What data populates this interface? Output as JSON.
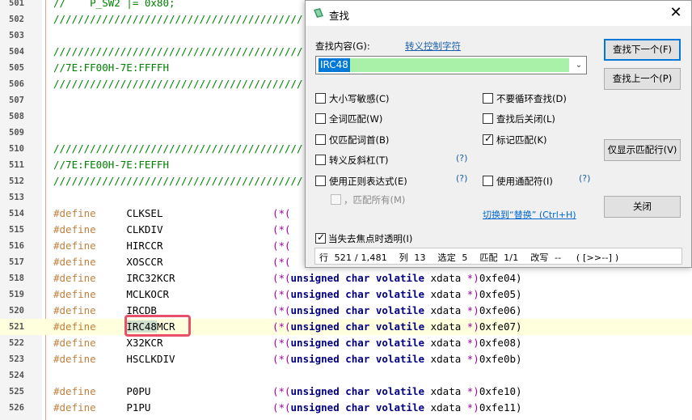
{
  "editor": {
    "lines": [
      {
        "num": "501",
        "parts": [
          [
            "cmt",
            "//    P_SW2 |= 0x80;"
          ]
        ]
      },
      {
        "num": "502",
        "parts": [
          [
            "cmt",
            "/////////////////////////////////////////"
          ]
        ]
      },
      {
        "num": "503",
        "parts": []
      },
      {
        "num": "504",
        "parts": [
          [
            "cmt",
            "/////////////////////////////////////////"
          ]
        ]
      },
      {
        "num": "505",
        "parts": [
          [
            "cmt",
            "//7E:FF00H-7E:FFFFH"
          ]
        ]
      },
      {
        "num": "506",
        "parts": [
          [
            "cmt",
            "/////////////////////////////////////////"
          ]
        ]
      },
      {
        "num": "507",
        "parts": []
      },
      {
        "num": "508",
        "parts": []
      },
      {
        "num": "509",
        "parts": []
      },
      {
        "num": "510",
        "parts": [
          [
            "cmt",
            "/////////////////////////////////////////"
          ]
        ]
      },
      {
        "num": "511",
        "parts": [
          [
            "cmt",
            "//7E:FE00H-7E:FEFFH"
          ]
        ]
      },
      {
        "num": "512",
        "parts": [
          [
            "cmt",
            "/////////////////////////////////////////"
          ]
        ]
      },
      {
        "num": "513",
        "parts": []
      },
      {
        "num": "514",
        "parts": [
          [
            "kw-define",
            "#define     "
          ],
          [
            "name",
            "CLKSEL                  "
          ],
          [
            "par",
            "(*("
          ]
        ]
      },
      {
        "num": "515",
        "parts": [
          [
            "kw-define",
            "#define     "
          ],
          [
            "name",
            "CLKDIV                  "
          ],
          [
            "par",
            "(*("
          ]
        ]
      },
      {
        "num": "516",
        "parts": [
          [
            "kw-define",
            "#define     "
          ],
          [
            "name",
            "HIRCCR                  "
          ],
          [
            "par",
            "(*("
          ]
        ]
      },
      {
        "num": "517",
        "parts": [
          [
            "kw-define",
            "#define     "
          ],
          [
            "name",
            "XOSCCR                  "
          ],
          [
            "par",
            "(*("
          ]
        ]
      },
      {
        "num": "518",
        "parts": [
          [
            "kw-define",
            "#define     "
          ],
          [
            "name",
            "IRC32KCR                "
          ],
          [
            "par",
            "(*("
          ],
          [
            "ty",
            "unsigned char volatile"
          ],
          [
            "hex",
            " xdata "
          ],
          [
            "par",
            "*)"
          ],
          [
            "hex",
            "0xfe04)"
          ]
        ]
      },
      {
        "num": "519",
        "parts": [
          [
            "kw-define",
            "#define     "
          ],
          [
            "name",
            "MCLKOCR                 "
          ],
          [
            "par",
            "(*("
          ],
          [
            "ty",
            "unsigned char volatile"
          ],
          [
            "hex",
            " xdata "
          ],
          [
            "par",
            "*)"
          ],
          [
            "hex",
            "0xfe05)"
          ]
        ]
      },
      {
        "num": "520",
        "parts": [
          [
            "kw-define",
            "#define     "
          ],
          [
            "name",
            "IRCDB                   "
          ],
          [
            "par",
            "(*("
          ],
          [
            "ty",
            "unsigned char volatile"
          ],
          [
            "hex",
            " xdata "
          ],
          [
            "par",
            "*)"
          ],
          [
            "hex",
            "0xfe06)"
          ]
        ]
      },
      {
        "num": "521",
        "current": true,
        "parts": [
          [
            "kw-define",
            "#define     "
          ],
          [
            "match",
            "IRC48"
          ],
          [
            "name",
            "MCR                "
          ],
          [
            "par",
            "(*("
          ],
          [
            "ty",
            "unsigned char volatile"
          ],
          [
            "hex",
            " xdata "
          ],
          [
            "par",
            "*)"
          ],
          [
            "hex",
            "0xfe07)"
          ]
        ]
      },
      {
        "num": "522",
        "parts": [
          [
            "kw-define",
            "#define     "
          ],
          [
            "name",
            "X32KCR                  "
          ],
          [
            "par",
            "(*("
          ],
          [
            "ty",
            "unsigned char volatile"
          ],
          [
            "hex",
            " xdata "
          ],
          [
            "par",
            "*)"
          ],
          [
            "hex",
            "0xfe08)"
          ]
        ]
      },
      {
        "num": "523",
        "parts": [
          [
            "kw-define",
            "#define     "
          ],
          [
            "name",
            "HSCLKDIV                "
          ],
          [
            "par",
            "(*("
          ],
          [
            "ty",
            "unsigned char volatile"
          ],
          [
            "hex",
            " xdata "
          ],
          [
            "par",
            "*)"
          ],
          [
            "hex",
            "0xfe0b)"
          ]
        ]
      },
      {
        "num": "524",
        "parts": []
      },
      {
        "num": "525",
        "parts": [
          [
            "kw-define",
            "#define     "
          ],
          [
            "name",
            "P0PU                    "
          ],
          [
            "par",
            "(*("
          ],
          [
            "ty",
            "unsigned char volatile"
          ],
          [
            "hex",
            " xdata "
          ],
          [
            "par",
            "*)"
          ],
          [
            "hex",
            "0xfe10)"
          ]
        ]
      },
      {
        "num": "526",
        "parts": [
          [
            "kw-define",
            "#define     "
          ],
          [
            "name",
            "P1PU                    "
          ],
          [
            "par",
            "(*("
          ],
          [
            "ty",
            "unsigned char volatile"
          ],
          [
            "hex",
            " xdata "
          ],
          [
            "par",
            "*)"
          ],
          [
            "hex",
            "0xfe11)"
          ]
        ]
      }
    ]
  },
  "dialog": {
    "title": "查找",
    "find_label": "查找内容(G):",
    "escape_link": "转义控制字符",
    "find_value": "IRC48",
    "buttons": {
      "find_next": "查找下一个(F)",
      "find_prev": "查找上一个(P)",
      "show_matches": "仅显示匹配行(V)",
      "close": "关闭"
    },
    "options_left": [
      {
        "label": "大小写敏感(C)",
        "checked": false
      },
      {
        "label": "全词匹配(W)",
        "checked": false
      },
      {
        "label": "仅匹配词首(B)",
        "checked": false
      },
      {
        "label": "转义反斜杠(T)",
        "checked": false
      },
      {
        "label": "使用正则表达式(E)",
        "checked": false
      }
    ],
    "options_right": [
      {
        "label": "不要循环查找(D)",
        "checked": false
      },
      {
        "label": "查找后关闭(L)",
        "checked": false
      },
      {
        "label": "标记匹配(K)",
        "checked": true
      },
      {
        "label": "使用通配符(I)",
        "checked": false
      }
    ],
    "help_mark": "(?)",
    "match_all": "，匹配所有(M)",
    "switch_replace": "切换到“替换” (Ctrl+H)",
    "transparent": "当失去焦点时透明(I)",
    "status": "行  521 / 1,481    列  13    选定  5    匹配  1/1    改写  --     ( [>>--] )"
  }
}
